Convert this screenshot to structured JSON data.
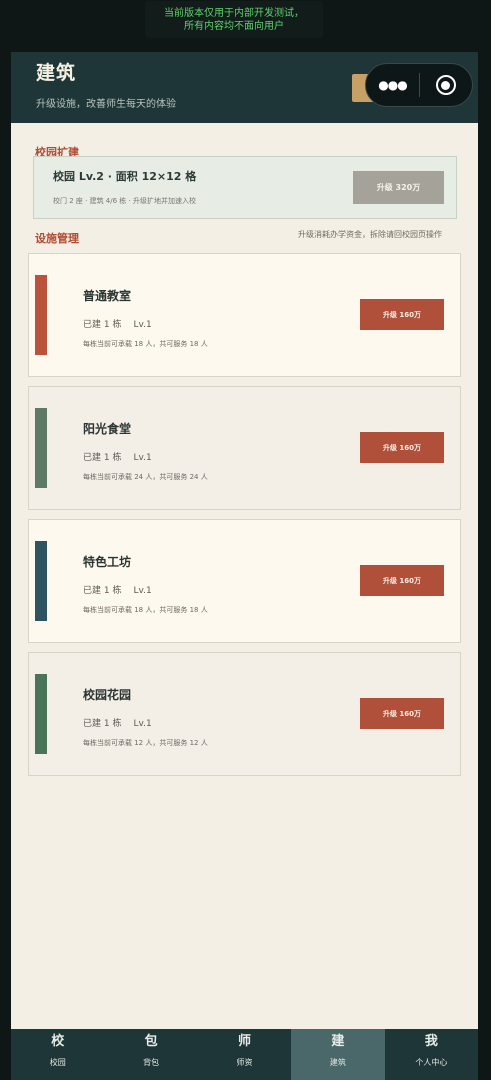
{
  "notice": {
    "line1": "当前版本仅用于内部开发测试，",
    "line2": "所有内容均不面向用户"
  },
  "header": {
    "title": "建筑",
    "subtitle": "升级设施，改善师生每天的体验",
    "menu_icon": "more-dots-icon",
    "close_icon": "target-circle-icon"
  },
  "campus_expand": {
    "section_title": "校园扩建",
    "title": "校园 Lv.2 · 面积 12×12 格",
    "description": "校门 2 座 · 建筑 4/6 栋 · 升级扩地并加速入校",
    "button": "升级 320万"
  },
  "facilities": {
    "section_title": "设施管理",
    "hint": "升级消耗办学资金，拆除请回校园页操作",
    "items": [
      {
        "name": "普通教室",
        "built": "已建 1 栋",
        "level": "Lv.1",
        "capacity": "每栋当前可承载 18 人，共可服务 18 人",
        "button": "升级 160万",
        "color": "#b9533b",
        "bg": "#fdf9ee"
      },
      {
        "name": "阳光食堂",
        "built": "已建 1 栋",
        "level": "Lv.1",
        "capacity": "每栋当前可承载 24 人，共可服务 24 人",
        "button": "升级 160万",
        "color": "#5c7a66",
        "bg": "#f3efe7"
      },
      {
        "name": "特色工坊",
        "built": "已建 1 栋",
        "level": "Lv.1",
        "capacity": "每栋当前可承载 18 人，共可服务 18 人",
        "button": "升级 160万",
        "color": "#2f5461",
        "bg": "#fdf9ee"
      },
      {
        "name": "校园花园",
        "built": "已建 1 栋",
        "level": "Lv.1",
        "capacity": "每栋当前可承载 12 人，共可服务 12 人",
        "button": "升级 160万",
        "color": "#4a7458",
        "bg": "#f3efe7"
      }
    ]
  },
  "tabbar": {
    "items": [
      {
        "glyph": "校",
        "label": "校园",
        "active": false
      },
      {
        "glyph": "包",
        "label": "背包",
        "active": false
      },
      {
        "glyph": "师",
        "label": "师资",
        "active": false
      },
      {
        "glyph": "建",
        "label": "建筑",
        "active": true
      },
      {
        "glyph": "我",
        "label": "个人中心",
        "active": false
      }
    ]
  }
}
